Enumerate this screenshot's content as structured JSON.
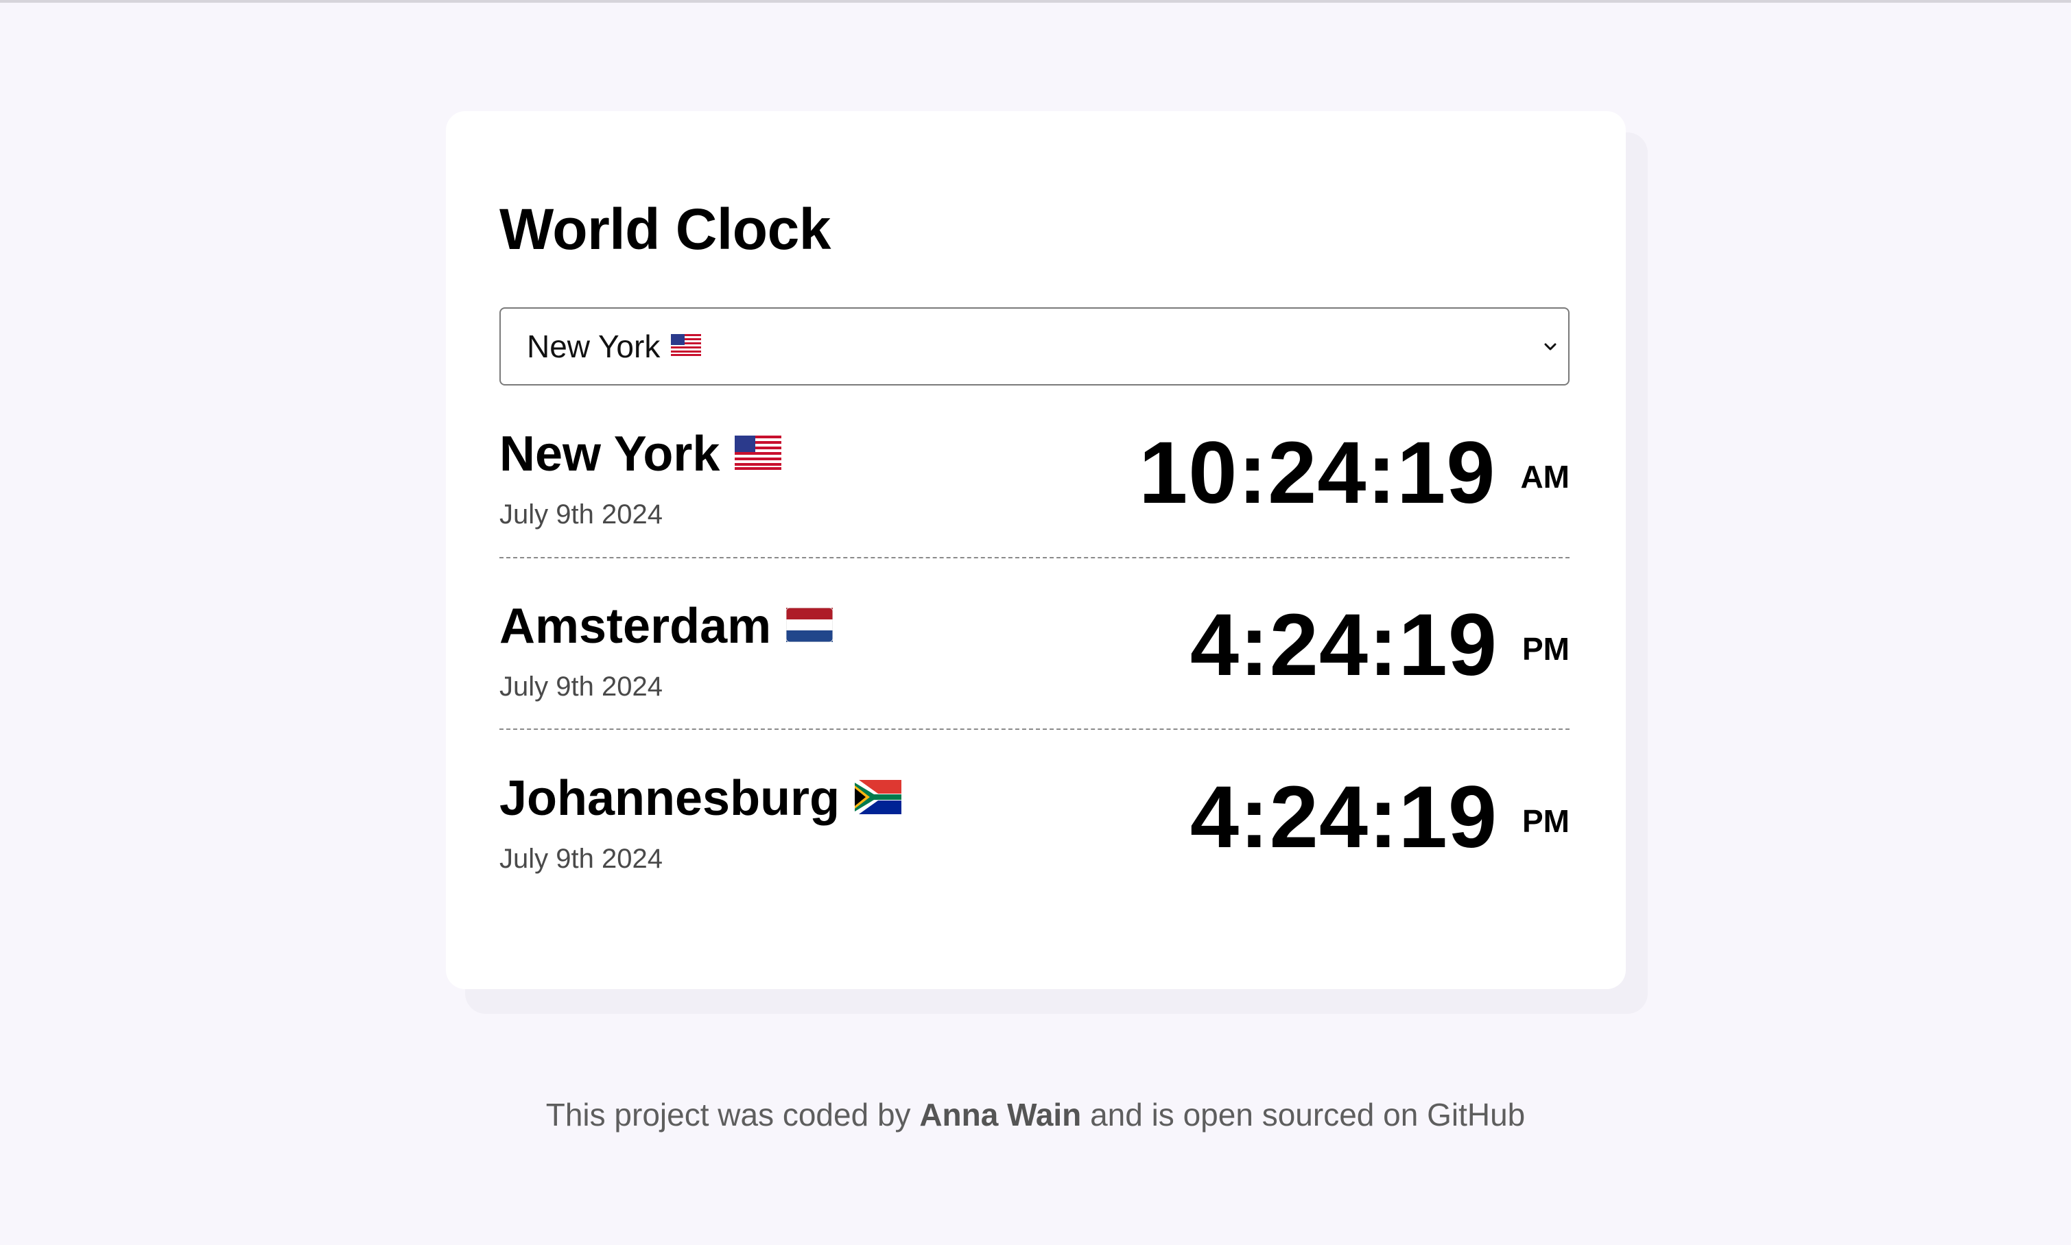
{
  "app": {
    "title": "World Clock"
  },
  "selector": {
    "selected_city": "New York",
    "selected_flag": "us-flag-icon"
  },
  "cities": [
    {
      "name": "New York",
      "flag": "us-flag-icon",
      "date": "July 9th 2024",
      "time": "10:24:19",
      "period": "AM"
    },
    {
      "name": "Amsterdam",
      "flag": "netherlands-flag-icon",
      "date": "July 9th 2024",
      "time": "4:24:19",
      "period": "PM"
    },
    {
      "name": "Johannesburg",
      "flag": "south-africa-flag-icon",
      "date": "July 9th 2024",
      "time": "4:24:19",
      "period": "PM"
    }
  ],
  "footer": {
    "prefix": "This project was coded by",
    "author": "Anna Wain",
    "middle": "and is",
    "link_text": "open sourced on GitHub"
  },
  "colors": {
    "page_background": "#f8f6fc",
    "card_background": "#ffffff",
    "text_primary": "#000000",
    "text_secondary": "#4a4a4a",
    "footer_text": "#5e5e5e"
  }
}
